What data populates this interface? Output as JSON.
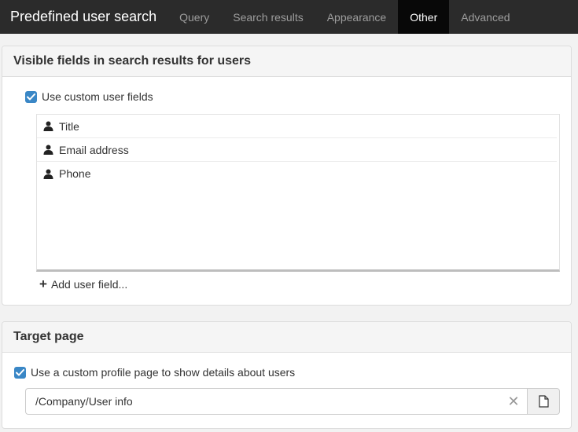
{
  "navbar": {
    "brand": "Predefined user search",
    "tabs": [
      {
        "label": "Query",
        "active": false
      },
      {
        "label": "Search results",
        "active": false
      },
      {
        "label": "Appearance",
        "active": false
      },
      {
        "label": "Other",
        "active": true
      },
      {
        "label": "Advanced",
        "active": false
      }
    ]
  },
  "visible_fields": {
    "heading": "Visible fields in search results for users",
    "use_custom_label": "Use custom user fields",
    "use_custom_checked": true,
    "fields": [
      {
        "label": "Title",
        "icon": "user-icon"
      },
      {
        "label": "Email address",
        "icon": "user-icon"
      },
      {
        "label": "Phone",
        "icon": "user-icon"
      }
    ],
    "add_label": "Add user field..."
  },
  "target_page": {
    "heading": "Target page",
    "use_custom_label": "Use a custom profile page to show details about users",
    "use_custom_checked": true,
    "page_value": "/Company/User info"
  },
  "colors": {
    "navbar_bg": "#2b2b2b",
    "active_tab_bg": "#080808",
    "checkbox_blue": "#3a87c6"
  }
}
